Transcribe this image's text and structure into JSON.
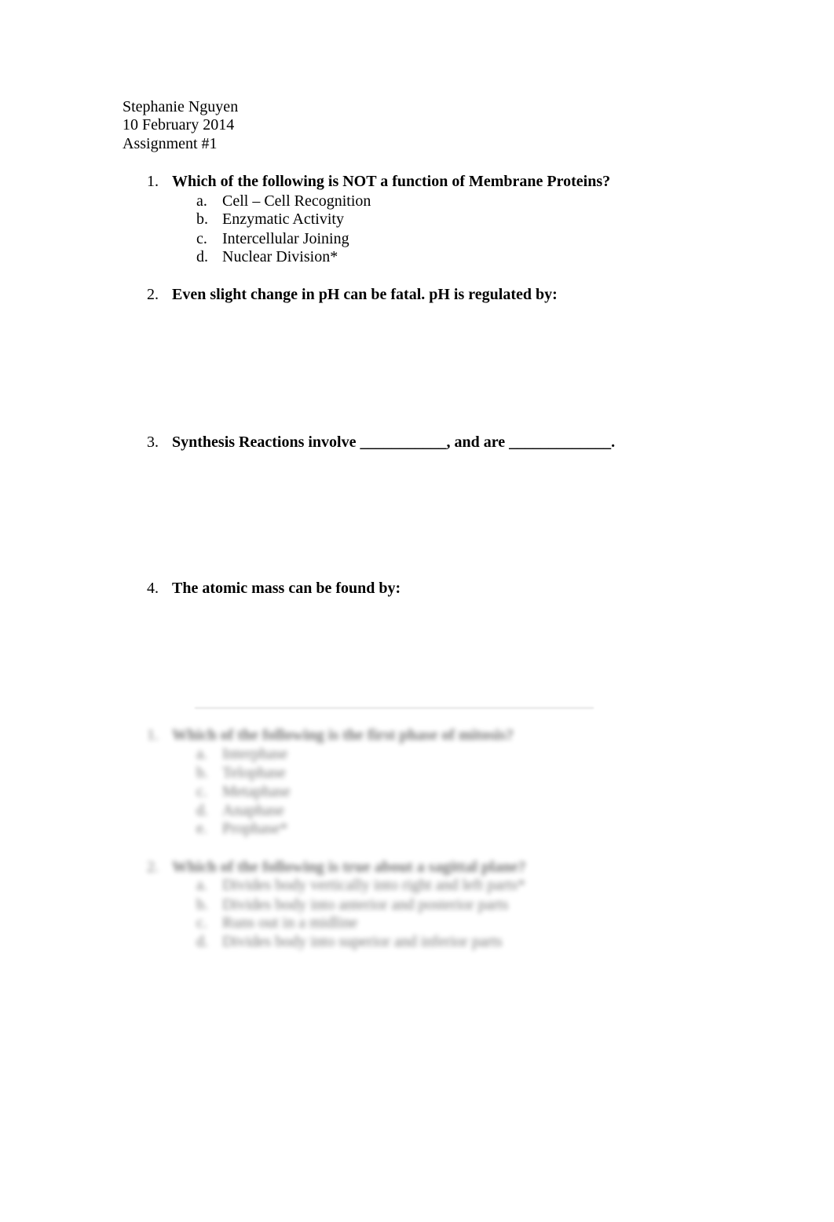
{
  "header": {
    "name": "Stephanie Nguyen",
    "date": "10 February 2014",
    "assignment": "Assignment #1"
  },
  "questions": [
    {
      "number": "1.",
      "text": "Which of the following is NOT a function of Membrane Proteins?",
      "options": [
        {
          "letter": "a.",
          "text": "Cell – Cell Recognition"
        },
        {
          "letter": "b.",
          "text": "Enzymatic Activity"
        },
        {
          "letter": "c.",
          "text": "Intercellular Joining"
        },
        {
          "letter": "d.",
          "text": "Nuclear Division*"
        }
      ]
    },
    {
      "number": "2.",
      "text": "Even slight change in pH can be fatal. pH is regulated by:"
    },
    {
      "number": "3.",
      "text": "Synthesis Reactions involve ___________, and are _____________."
    },
    {
      "number": "4.",
      "text": "The atomic mass can be found by:"
    }
  ],
  "blurred_section": {
    "questions": [
      {
        "number": "1.",
        "text": "Which of the following is the first phase of mitosis?",
        "options": [
          {
            "letter": "a.",
            "text": "Interphase"
          },
          {
            "letter": "b.",
            "text": "Telophase"
          },
          {
            "letter": "c.",
            "text": "Metaphase"
          },
          {
            "letter": "d.",
            "text": "Anaphase"
          },
          {
            "letter": "e.",
            "text": "Prophase*"
          }
        ]
      },
      {
        "number": "2.",
        "text": "Which of the following is true about a sagittal plane?",
        "options": [
          {
            "letter": "a.",
            "text": "Divides body vertically into right and left parts*"
          },
          {
            "letter": "b.",
            "text": "Divides body into anterior and posterior parts"
          },
          {
            "letter": "c.",
            "text": "Runs out in a midline"
          },
          {
            "letter": "d.",
            "text": "Divides body into superior and inferior parts"
          }
        ]
      }
    ]
  }
}
